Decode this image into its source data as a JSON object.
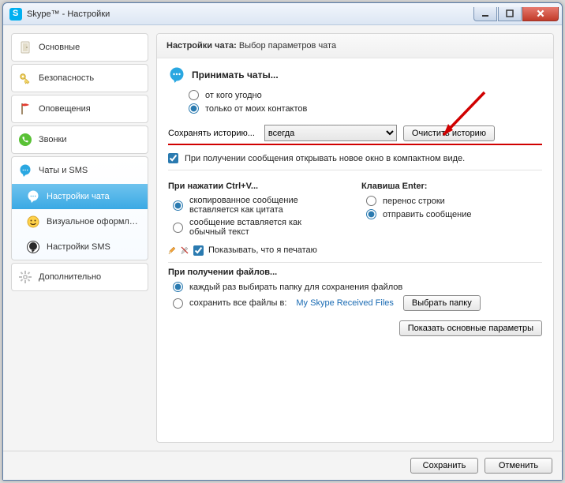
{
  "window": {
    "title": "Skype™ - Настройки"
  },
  "sidebar": {
    "general": "Основные",
    "security": "Безопасность",
    "alerts": "Оповещения",
    "calls": "Звонки",
    "chats": "Чаты и SMS",
    "chat_settings": "Настройки чата",
    "visual": "Визуальное оформлен...",
    "sms_settings": "Настройки SMS",
    "advanced": "Дополнительно"
  },
  "main": {
    "header_bold": "Настройки чата:",
    "header_rest": " Выбор параметров чата",
    "accept_title": "Принимать чаты...",
    "accept_any": "от кого угодно",
    "accept_contacts": "только от моих контактов",
    "history_label": "Сохранять историю...",
    "history_value": "всегда",
    "clear_history": "Очистить историю",
    "compact_check": "При получении сообщения открывать новое окно в компактном виде.",
    "ctrlv_title": "При нажатии Ctrl+V...",
    "ctrlv_quote": "скопированное сообщение вставляется как цитата",
    "ctrlv_plain": "сообщение вставляется как обычный текст",
    "typing_label": "Показывать, что я печатаю",
    "enter_title": "Клавиша Enter:",
    "enter_newline": "перенос строки",
    "enter_send": "отправить сообщение",
    "files_title": "При получении файлов...",
    "files_ask": "каждый раз выбирать папку для сохранения файлов",
    "files_save": "сохранить все файлы в:",
    "files_folder": "My Skype Received Files",
    "choose_folder": "Выбрать папку",
    "show_basic": "Показать основные параметры"
  },
  "footer": {
    "save": "Сохранить",
    "cancel": "Отменить"
  }
}
